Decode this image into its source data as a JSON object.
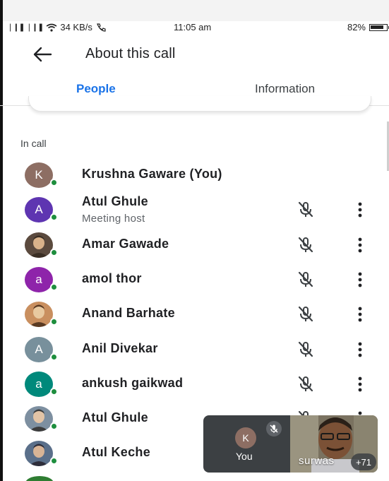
{
  "status_bar": {
    "signal": "4G ❘❘❘ 4G ❘❘❘",
    "wifi_icon": "wifi-icon",
    "speed": "34 KB/s",
    "call_icon": "wifi-call-icon",
    "time": "11:05 am",
    "battery": "82%"
  },
  "header": {
    "title": "About this call",
    "back_icon": "arrow-back-icon"
  },
  "tabs": [
    {
      "label": "People",
      "active": true
    },
    {
      "label": "Information",
      "active": false
    }
  ],
  "section_label": "In call",
  "participants": [
    {
      "name": "Krushna Gaware (You)",
      "avatar_letter": "K",
      "avatar_color": "#8d6e63",
      "photo": false,
      "muted_icon": false,
      "more_icon": false
    },
    {
      "name": "Atul Ghule",
      "subtitle": "Meeting host",
      "avatar_letter": "A",
      "avatar_color": "#5e35b1",
      "photo": false,
      "muted_icon": true,
      "more_icon": true
    },
    {
      "name": "Amar Gawade",
      "avatar_letter": "",
      "avatar_color": "#7a6a5a",
      "photo": true,
      "muted_icon": true,
      "more_icon": true
    },
    {
      "name": "amol thor",
      "avatar_letter": "a",
      "avatar_color": "#8e24aa",
      "photo": false,
      "muted_icon": true,
      "more_icon": true
    },
    {
      "name": "Anand Barhate",
      "avatar_letter": "",
      "avatar_color": "#b07a4a",
      "photo": true,
      "muted_icon": true,
      "more_icon": true
    },
    {
      "name": "Anil Divekar",
      "avatar_letter": "A",
      "avatar_color": "#78909c",
      "photo": false,
      "muted_icon": true,
      "more_icon": true
    },
    {
      "name": "ankush gaikwad",
      "avatar_letter": "a",
      "avatar_color": "#00897b",
      "photo": false,
      "muted_icon": true,
      "more_icon": true
    },
    {
      "name": "Atul Ghule",
      "avatar_letter": "",
      "avatar_color": "#9b8070",
      "photo": true,
      "muted_icon": true,
      "more_icon": true
    },
    {
      "name": "Atul Keche",
      "avatar_letter": "",
      "avatar_color": "#6a7a8a",
      "photo": true,
      "muted_icon": false,
      "more_icon": false
    }
  ],
  "self_tile": {
    "avatar_letter": "K",
    "label": "You",
    "mic_icon": "mic-off-icon"
  },
  "video_tile": {
    "name": "surwas",
    "more_count": "+71"
  },
  "colors": {
    "accent": "#1a73e8",
    "online": "#1e8e3e",
    "tile_bg": "#3c4043"
  }
}
